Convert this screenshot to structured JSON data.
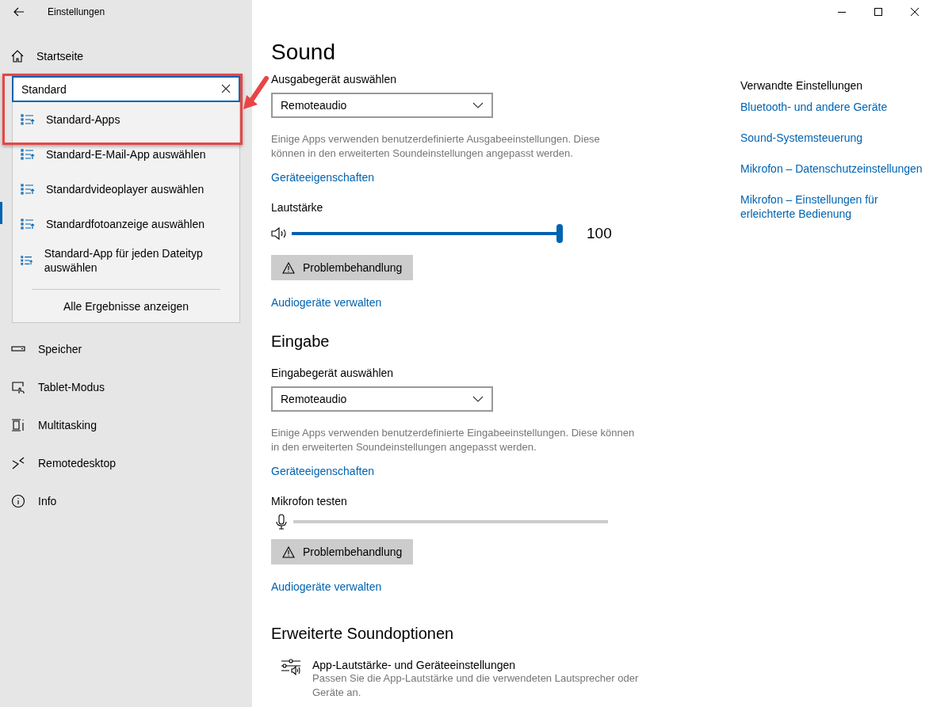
{
  "window": {
    "title": "Einstellungen"
  },
  "sidebar": {
    "home": "Startseite",
    "search": {
      "value": "Standard"
    },
    "results": [
      {
        "label": "Standard-Apps"
      },
      {
        "label": "Standard-E-Mail-App auswählen"
      },
      {
        "label": "Standardvideoplayer auswählen"
      },
      {
        "label": "Standardfotoanzeige auswählen"
      },
      {
        "label": "Standard-App für jeden Dateityp auswählen"
      }
    ],
    "show_all": "Alle Ergebnisse anzeigen",
    "items": [
      {
        "label": "Speicher",
        "kind": "storage"
      },
      {
        "label": "Tablet-Modus",
        "kind": "tablet"
      },
      {
        "label": "Multitasking",
        "kind": "multitasking"
      },
      {
        "label": "Remotedesktop",
        "kind": "remote"
      },
      {
        "label": "Info",
        "kind": "info"
      }
    ]
  },
  "main": {
    "title": "Sound",
    "output": {
      "label": "Ausgabegerät auswählen",
      "device": "Remoteaudio",
      "note": "Einige Apps verwenden benutzerdefinierte Ausgabeeinstellungen. Diese können in den erweiterten Soundeinstellungen angepasst werden.",
      "properties_link": "Geräteeigenschaften",
      "volume_label": "Lautstärke",
      "volume": {
        "level": 1,
        "reading": "100"
      },
      "troubleshoot": "Problembehandlung",
      "manage_link": "Audiogeräte verwalten"
    },
    "input": {
      "heading": "Eingabe",
      "label": "Eingabegerät auswählen",
      "device": "Remoteaudio",
      "note": "Einige Apps verwenden benutzerdefinierte Eingabeeinstellungen. Diese können in den erweiterten Soundeinstellungen angepasst werden.",
      "properties_link": "Geräteeigenschaften",
      "mic_label": "Mikrofon testen",
      "mic_meter": {
        "level": 0
      },
      "troubleshoot": "Problembehandlung",
      "manage_link": "Audiogeräte verwalten"
    },
    "advanced": {
      "heading": "Erweiterte Soundoptionen",
      "items": [
        {
          "title": "App-Lautstärke- und Geräteeinstellungen",
          "description": "Passen Sie die App-Lautstärke und die verwendeten Lautsprecher oder Geräte an."
        }
      ]
    }
  },
  "related": {
    "heading": "Verwandte Einstellungen",
    "links": [
      "Bluetooth- und andere Geräte",
      "Sound-Systemsteuerung",
      "Mikrofon – Datenschutzeinstellungen",
      "Mikrofon – Einstellungen für erleichterte Bedienung"
    ]
  }
}
